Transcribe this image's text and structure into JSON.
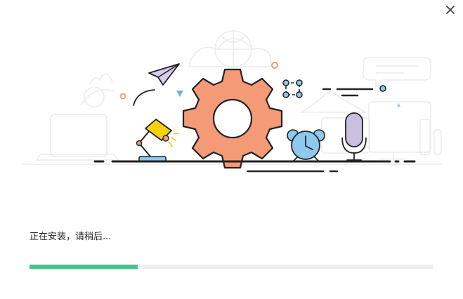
{
  "window": {
    "close_icon": "close-icon"
  },
  "illustration": {
    "icons": [
      "paper-plane-icon",
      "desk-lamp-icon",
      "gear-icon",
      "alarm-clock-icon",
      "microphone-icon",
      "crop-icon"
    ],
    "colors": {
      "gear": "#f49a76",
      "lamp": "#f5d20c",
      "clock": "#8ec8ee",
      "mic": "#c8c0de",
      "plane": "#d6cdf0",
      "outline": "#222222",
      "line_art": "#eeeeee"
    }
  },
  "install": {
    "status_text": "正在安装，请稍后...",
    "progress_fraction": 0.268,
    "progress_color": "#47c38a",
    "track_color": "#eeeef4"
  }
}
